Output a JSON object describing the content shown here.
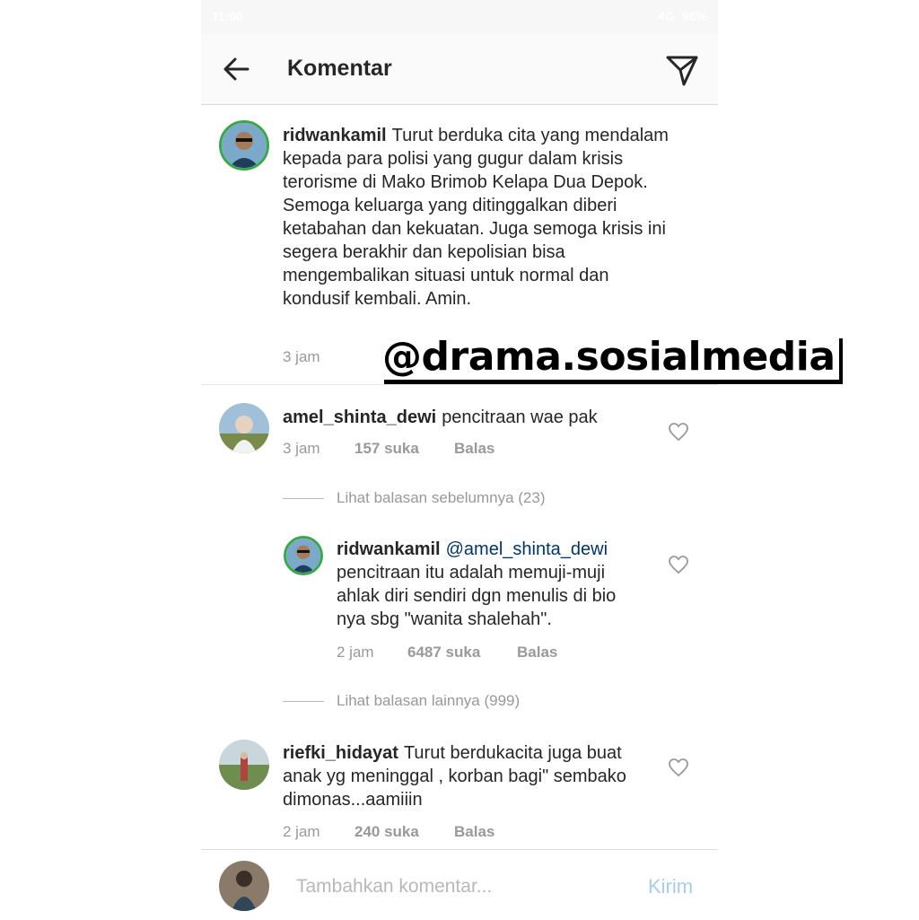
{
  "status": {
    "time": "11:00",
    "network": "4G",
    "battery": "96%"
  },
  "header": {
    "title": "Komentar"
  },
  "caption": {
    "username": "ridwankamil",
    "text": "Turut berduka cita yang mendalam kepada para polisi yang gugur dalam krisis terorisme di Mako Brimob Kelapa Dua Depok. Semoga keluarga yang ditinggalkan diberi ketabahan dan kekuatan. Juga semoga krisis ini segera berakhir dan kepolisian bisa mengembalikan situasi  untuk normal dan kondusif kembali.  Amin.",
    "time": "3 jam"
  },
  "watermark": "@drama.sosialmedia",
  "comments": [
    {
      "username": "amel_shinta_dewi",
      "text": "pencitraan wae pak",
      "time": "3 jam",
      "likes": "157 suka",
      "reply": "Balas"
    },
    {
      "username": "riefki_hidayat",
      "text": "Turut berdukacita juga buat anak yg meninggal , korban bagi\" sembako dimonas...aamiiin",
      "time": "2 jam",
      "likes": "240 suka",
      "reply": "Balas"
    }
  ],
  "view_previous_replies": "Lihat balasan sebelumnya (23)",
  "reply": {
    "username": "ridwankamil",
    "mention": "@amel_shinta_dewi",
    "text": "pencitraan itu adalah memuji-muji ahlak diri sendiri dgn menulis di bio nya sbg \"wanita shalehah\".",
    "time": "2 jam",
    "likes": "6487 suka",
    "reply": "Balas"
  },
  "view_more_replies": "Lihat balasan lainnya (999)",
  "composer": {
    "placeholder": "Tambahkan komentar...",
    "send_label": "Kirim"
  },
  "colors": {
    "ring": "#3aa84a",
    "link_blue": "#a7cdec",
    "meta_gray": "#999999"
  }
}
